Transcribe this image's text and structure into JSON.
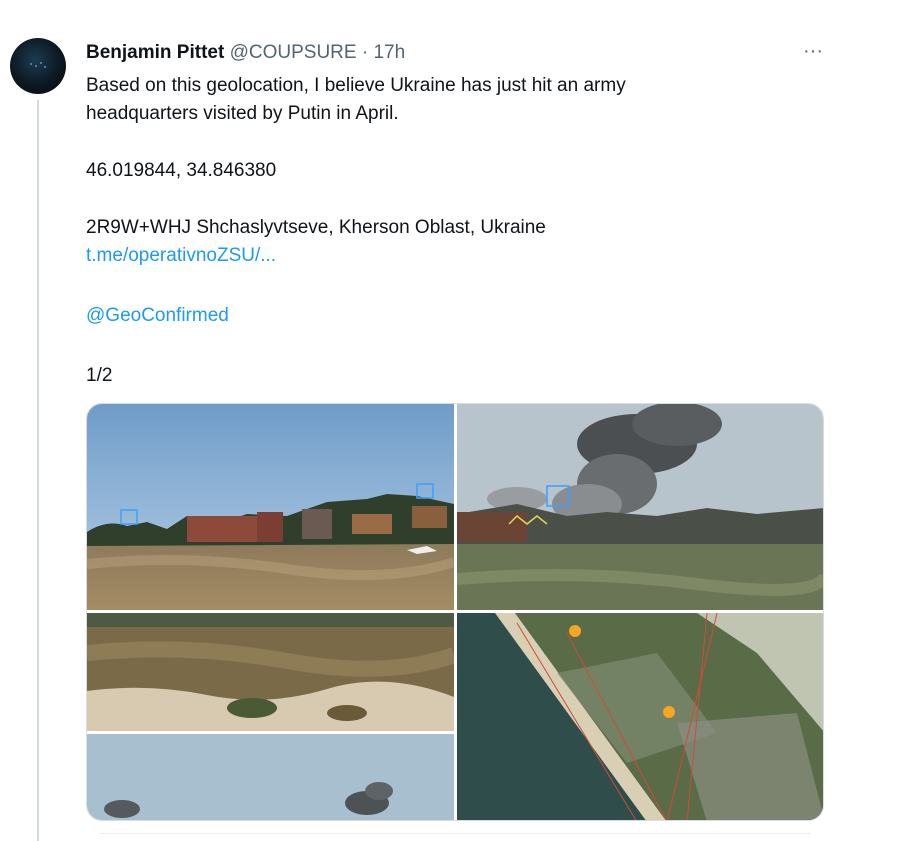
{
  "author": {
    "name": "Benjamin Pittet",
    "handle": "@COUPSURE",
    "separator": "·",
    "time": "17h"
  },
  "more_label": "···",
  "tweet": {
    "line1": "Based on this geolocation, I believe Ukraine has just hit an army",
    "line2": "headquarters visited by Putin in April.",
    "coords": "46.019844, 34.846380",
    "plus_code": "2R9W+WHJ Shchaslyvtseve, Kherson Oblast, Ukraine",
    "link": "t.me/operativnoZSU/...",
    "mention": "@GeoConfirmed",
    "counter": "1/2"
  },
  "colors": {
    "link": "#1d9bf0",
    "secondary_text": "#536471",
    "thread_line": "#cfd9de"
  },
  "media": [
    {
      "id": "photo-1",
      "subject": "field with buildings and tree line, marked with blue boxes"
    },
    {
      "id": "photo-2",
      "subject": "dark smoke plume above buildings, marked with blue box and yellow outline"
    },
    {
      "id": "photo-3",
      "subject": "dry grass field and sand, lower photo with smoke plumes on sky"
    },
    {
      "id": "photo-4",
      "subject": "satellite map of coastline with two orange markers and red sight lines"
    }
  ]
}
